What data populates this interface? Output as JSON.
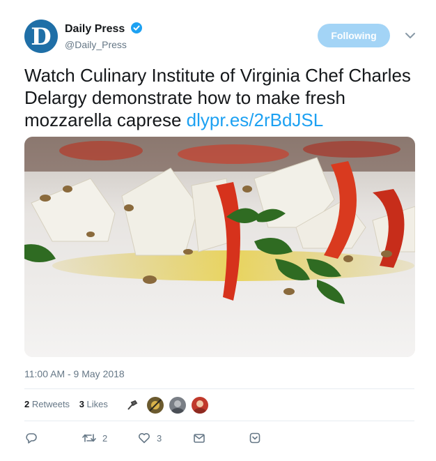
{
  "author": {
    "name": "Daily Press",
    "handle": "@Daily_Press",
    "avatar_letter": "D",
    "verified_icon": "verified-badge-icon"
  },
  "follow_button": {
    "label": "Following"
  },
  "tweet": {
    "text": "Watch Culinary Institute of Virginia Chef Charles Delargy demonstrate how to make fresh mozzarella caprese",
    "link": "dlypr.es/2rBdJSL"
  },
  "timestamp": "11:00 AM - 9 May 2018",
  "stats": {
    "retweets_count": "2",
    "retweets_label": "Retweets",
    "likes_count": "3",
    "likes_label": "Likes"
  },
  "actions": {
    "reply_icon": "reply-icon",
    "retweet_icon": "retweet-icon",
    "retweet_count": "2",
    "like_icon": "heart-icon",
    "like_count": "3",
    "dm_icon": "envelope-icon",
    "more_icon": "chevron-down-icon"
  },
  "colors": {
    "accent": "#1da1f2",
    "follow_bg": "#a3d4f6",
    "muted": "#657786",
    "avatar_bg": "#1f6fa7"
  }
}
